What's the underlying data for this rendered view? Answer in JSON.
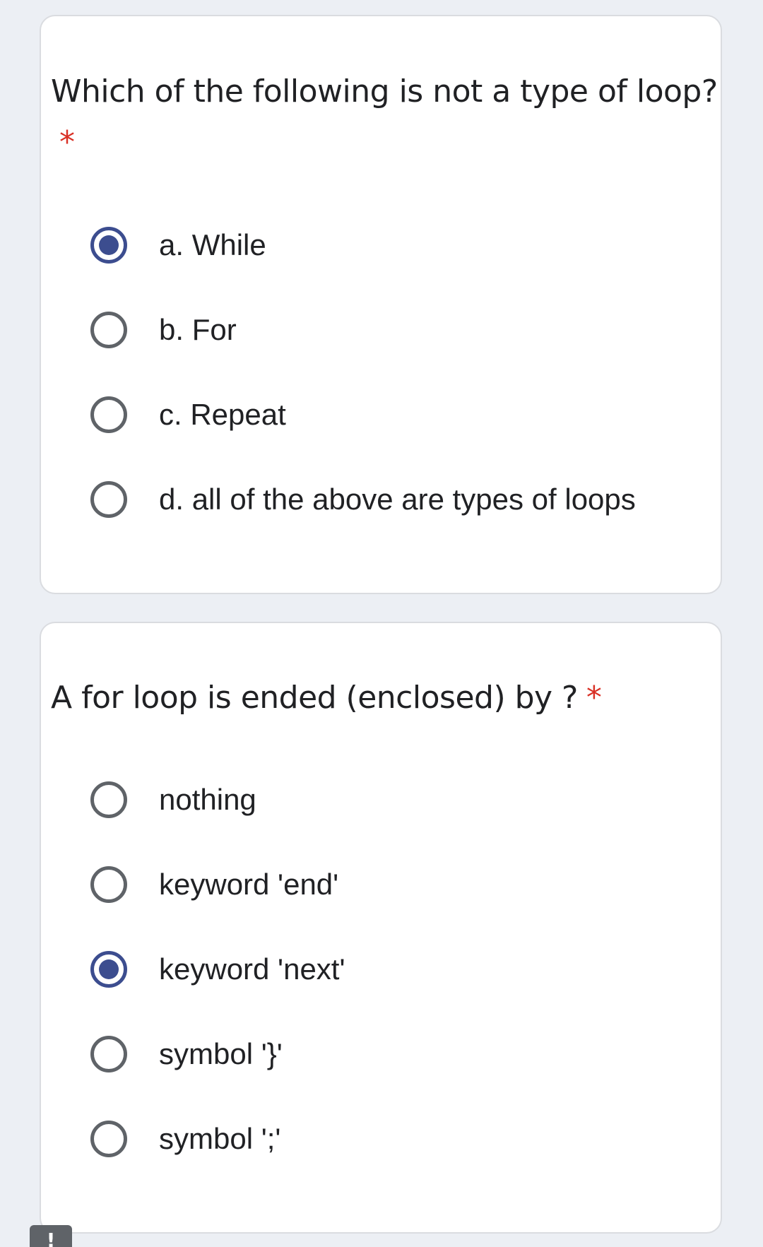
{
  "questions": [
    {
      "text": "Which of the following is not a type of loop?",
      "required_marker": "*",
      "options": [
        {
          "label": "a. While",
          "selected": true
        },
        {
          "label": "b. For",
          "selected": false
        },
        {
          "label": "c. Repeat",
          "selected": false
        },
        {
          "label": "d. all of the above are types of loops",
          "selected": false
        }
      ]
    },
    {
      "text": "A for loop is ended (enclosed) by ?",
      "required_marker": "*",
      "options": [
        {
          "label": "nothing",
          "selected": false
        },
        {
          "label": "keyword 'end'",
          "selected": false
        },
        {
          "label": "keyword 'next'",
          "selected": true
        },
        {
          "label": "symbol '}'",
          "selected": false
        },
        {
          "label": "symbol ';'",
          "selected": false
        }
      ]
    }
  ],
  "report_button": {
    "icon": "exclamation-icon",
    "glyph": "!"
  },
  "colors": {
    "page_background": "#eceff4",
    "card_background": "#ffffff",
    "accent": "#3c4d8f",
    "required": "#d93025",
    "radio_unselected": "#5f6368"
  }
}
